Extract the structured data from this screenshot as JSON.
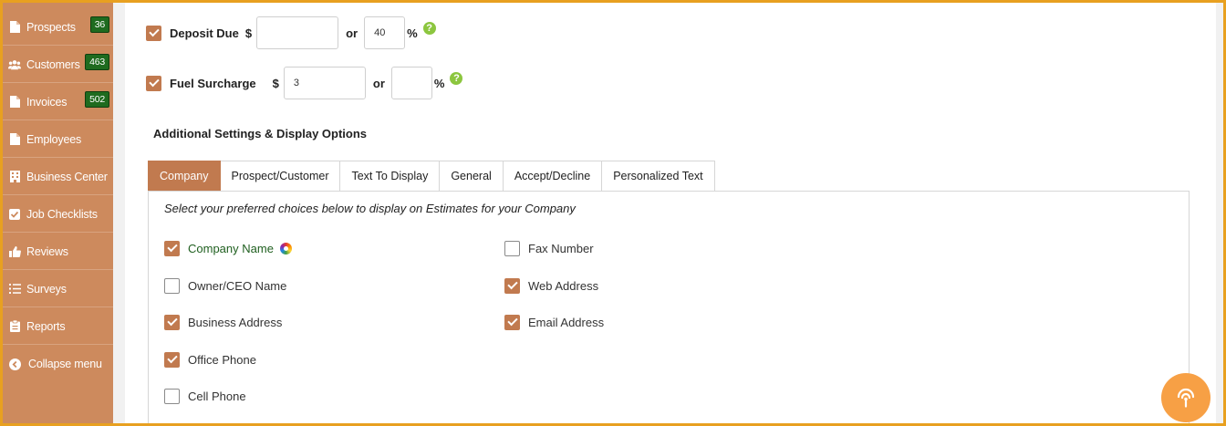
{
  "sidebar": {
    "items": [
      {
        "label": "Prospects",
        "icon": "file-icon",
        "badge": "36"
      },
      {
        "label": "Customers",
        "icon": "users-icon",
        "badge": "463"
      },
      {
        "label": "Invoices",
        "icon": "file-icon",
        "badge": "502"
      },
      {
        "label": "Employees",
        "icon": "file-icon",
        "badge": null
      },
      {
        "label": "Business Center",
        "icon": "building-icon",
        "badge": null
      },
      {
        "label": "Job Checklists",
        "icon": "checkbox-icon",
        "badge": null
      },
      {
        "label": "Reviews",
        "icon": "thumbs-up-icon",
        "badge": null
      },
      {
        "label": "Surveys",
        "icon": "list-icon",
        "badge": null
      },
      {
        "label": "Reports",
        "icon": "clipboard-icon",
        "badge": null
      },
      {
        "label": "Collapse menu",
        "icon": "chevron-left-circle-icon",
        "badge": null
      }
    ]
  },
  "deposit": {
    "label": "Deposit Due",
    "checked": true,
    "currency": "$",
    "amount": "",
    "or": "or",
    "percent": "40",
    "percent_sign": "%",
    "help": "?"
  },
  "fuel": {
    "label": "Fuel Surcharge",
    "checked": true,
    "currency": "$",
    "amount": "3",
    "or": "or",
    "percent": "",
    "percent_sign": "%",
    "help": "?"
  },
  "section_title": "Additional Settings & Display Options",
  "tabs": [
    {
      "label": "Company",
      "active": true
    },
    {
      "label": "Prospect/Customer",
      "active": false
    },
    {
      "label": "Text To Display",
      "active": false
    },
    {
      "label": "General",
      "active": false
    },
    {
      "label": "Accept/Decline",
      "active": false
    },
    {
      "label": "Personalized Text",
      "active": false
    }
  ],
  "panel": {
    "description": "Select your preferred choices below to display on Estimates for your Company",
    "left_options": [
      {
        "label": "Company Name",
        "checked": true
      },
      {
        "label": "Owner/CEO Name",
        "checked": false
      },
      {
        "label": "Business Address",
        "checked": true
      },
      {
        "label": "Office Phone",
        "checked": true
      },
      {
        "label": "Cell Phone",
        "checked": false
      }
    ],
    "right_options": [
      {
        "label": "Fax Number",
        "checked": false
      },
      {
        "label": "Web Address",
        "checked": true
      },
      {
        "label": "Email Address",
        "checked": true
      }
    ]
  },
  "colors": {
    "accent": "#c17a4f",
    "sidebar": "#cd8a5d",
    "badge": "#1f6b1f",
    "help": "#8cc63f",
    "frame": "#e8a020"
  }
}
